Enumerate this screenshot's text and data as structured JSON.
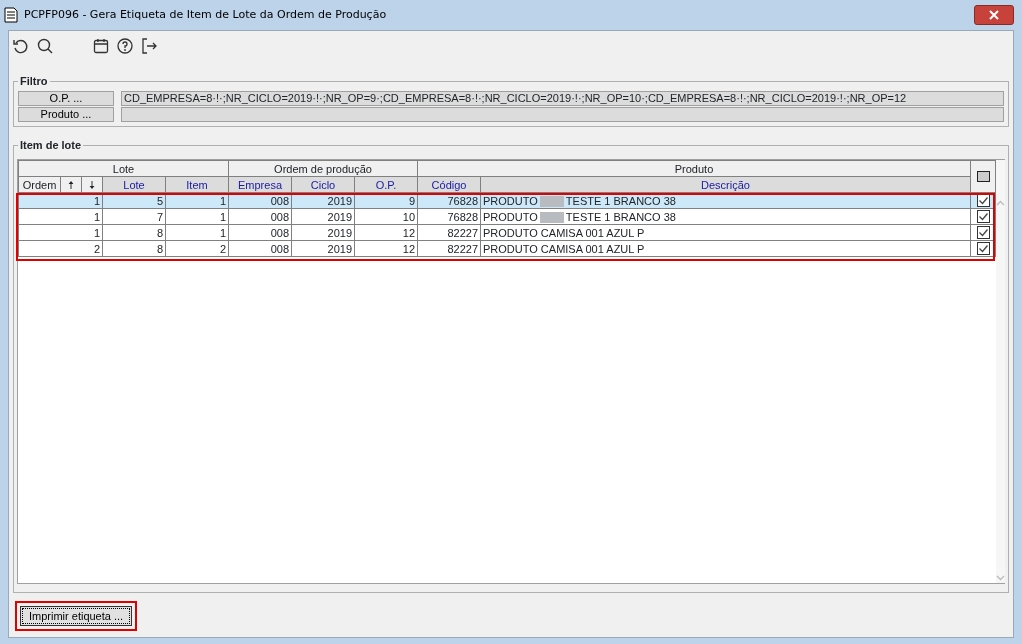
{
  "window": {
    "title": "PCPFP096 - Gera Etiqueta de Item de Lote da Ordem de Produção"
  },
  "filter": {
    "title": "Filtro",
    "fields": [
      {
        "button": "O.P. ...",
        "value": "CD_EMPRESA=8·!·;NR_CICLO=2019·!·;NR_OP=9·;CD_EMPRESA=8·!·;NR_CICLO=2019·!·;NR_OP=10·;CD_EMPRESA=8·!·;NR_CICLO=2019·!·;NR_OP=12"
      },
      {
        "button": "Produto ..."
      }
    ]
  },
  "items": {
    "title": "Item de lote",
    "groups": [
      {
        "label": "Lote"
      },
      {
        "label": "Ordem de produção"
      },
      {
        "label": "Produto"
      }
    ],
    "select_all_indeterminate": true,
    "columns": [
      {
        "label": "Ordem",
        "kind": "plain"
      },
      {
        "label": "🠅",
        "kind": "arrow"
      },
      {
        "label": "🠇",
        "kind": "arrow"
      },
      {
        "label": "Lote",
        "kind": "sort"
      },
      {
        "label": "Item",
        "kind": "sort"
      },
      {
        "label": "Empresa",
        "kind": "sort"
      },
      {
        "label": "Ciclo",
        "kind": "sort"
      },
      {
        "label": "O.P.",
        "kind": "sort"
      },
      {
        "label": "Código",
        "kind": "sort"
      },
      {
        "label": "Descrição",
        "kind": "sort"
      }
    ],
    "highlighted": true,
    "rows": [
      {
        "selected": true,
        "ordem": "1",
        "lote": "5",
        "item": "1",
        "empresa": "008",
        "ciclo": "2019",
        "op": "9",
        "codigo": "76828",
        "descricao": "PRODUTO",
        "redacted": true,
        "descricao_rest": "TESTE 1 BRANCO 38",
        "checked": true
      },
      {
        "selected": false,
        "ordem": "1",
        "lote": "7",
        "item": "1",
        "empresa": "008",
        "ciclo": "2019",
        "op": "10",
        "codigo": "76828",
        "descricao": "PRODUTO",
        "redacted": true,
        "descricao_rest": "TESTE 1 BRANCO 38",
        "checked": true
      },
      {
        "selected": false,
        "ordem": "1",
        "lote": "8",
        "item": "1",
        "empresa": "008",
        "ciclo": "2019",
        "op": "12",
        "codigo": "82227",
        "descricao": "PRODUTO CAMISA 001 AZUL P",
        "redacted": false,
        "checked": true
      },
      {
        "selected": false,
        "ordem": "2",
        "lote": "8",
        "item": "2",
        "empresa": "008",
        "ciclo": "2019",
        "op": "12",
        "codigo": "82227",
        "descricao": "PRODUTO CAMISA 001 AZUL P",
        "redacted": false,
        "checked": true
      }
    ]
  },
  "print_button": {
    "label": "Imprimir etiqueta ...",
    "highlighted": true
  }
}
